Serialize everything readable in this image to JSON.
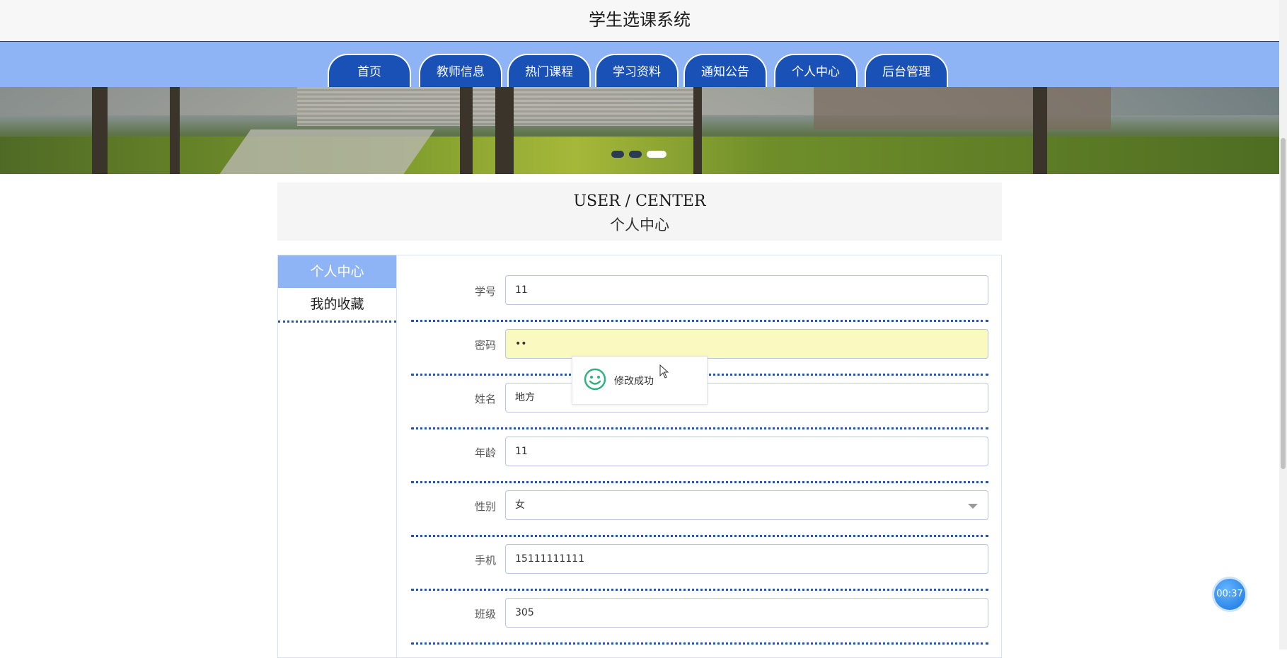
{
  "app": {
    "title": "学生选课系统"
  },
  "nav": {
    "items": [
      {
        "label": "首页"
      },
      {
        "label": "教师信息"
      },
      {
        "label": "热门课程"
      },
      {
        "label": "学习资料"
      },
      {
        "label": "通知公告"
      },
      {
        "label": "个人中心"
      },
      {
        "label": "后台管理"
      }
    ]
  },
  "carousel": {
    "active_index": 2,
    "count": 3
  },
  "section": {
    "title_en": "USER / CENTER",
    "title_zh": "个人中心"
  },
  "sidebar": {
    "items": [
      {
        "label": "个人中心",
        "active": true
      },
      {
        "label": "我的收藏",
        "active": false
      }
    ]
  },
  "form": {
    "fields": [
      {
        "label": "学号",
        "value": "11"
      },
      {
        "label": "密码",
        "value": "••"
      },
      {
        "label": "姓名",
        "value": "地方"
      },
      {
        "label": "年龄",
        "value": "11"
      },
      {
        "label": "性别",
        "value": "女"
      },
      {
        "label": "手机",
        "value": "15111111111"
      },
      {
        "label": "班级",
        "value": "305"
      }
    ]
  },
  "toast": {
    "message": "修改成功",
    "icon": "smile-icon"
  },
  "timer": {
    "text": "00:37"
  },
  "colors": {
    "primary": "#1a51b6",
    "nav_bg": "#8fb4f5",
    "autofill": "#faf9c0",
    "success": "#2fb27f"
  }
}
